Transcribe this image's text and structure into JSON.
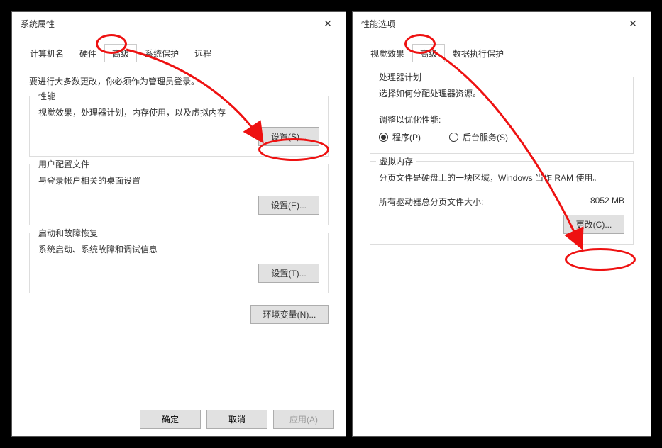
{
  "dlg1": {
    "title": "系统属性",
    "admin_note": "要进行大多数更改，你必须作为管理员登录。",
    "tabs": {
      "computer_name": "计算机名",
      "hardware": "硬件",
      "advanced": "高级",
      "system_protection": "系统保护",
      "remote": "远程"
    },
    "perf": {
      "legend": "性能",
      "desc": "视觉效果，处理器计划，内存使用，以及虚拟内存",
      "btn": "设置(S)..."
    },
    "profile": {
      "legend": "用户配置文件",
      "desc": "与登录帐户相关的桌面设置",
      "btn": "设置(E)..."
    },
    "startup": {
      "legend": "启动和故障恢复",
      "desc": "系统启动、系统故障和调试信息",
      "btn": "设置(T)..."
    },
    "env_btn": "环境变量(N)...",
    "footer": {
      "ok": "确定",
      "cancel": "取消",
      "apply": "应用(A)"
    }
  },
  "dlg2": {
    "title": "性能选项",
    "tabs": {
      "visual": "视觉效果",
      "advanced": "高级",
      "dep": "数据执行保护"
    },
    "sched": {
      "legend": "处理器计划",
      "desc": "选择如何分配处理器资源。",
      "adjust_label": "调整以优化性能:",
      "radio_programs": "程序(P)",
      "radio_services": "后台服务(S)"
    },
    "vmem": {
      "legend": "虚拟内存",
      "desc": "分页文件是硬盘上的一块区域，Windows 当作 RAM 使用。",
      "total_label": "所有驱动器总分页文件大小:",
      "total_value": "8052 MB",
      "btn": "更改(C)..."
    }
  }
}
